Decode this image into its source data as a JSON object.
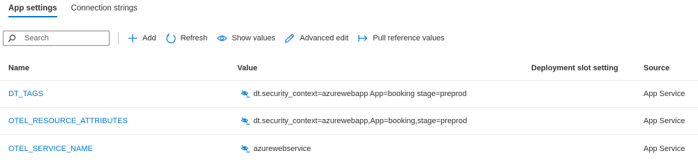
{
  "tabs": [
    {
      "label": "App settings",
      "active": true
    },
    {
      "label": "Connection strings",
      "active": false
    }
  ],
  "toolbar": {
    "search_placeholder": "Search",
    "add_label": "Add",
    "refresh_label": "Refresh",
    "show_values_label": "Show values",
    "advanced_edit_label": "Advanced edit",
    "pull_reference_label": "Pull reference values"
  },
  "table": {
    "headers": {
      "name": "Name",
      "value": "Value",
      "slot": "Deployment slot setting",
      "source": "Source"
    },
    "rows": [
      {
        "name": "DT_TAGS",
        "value": "dt.security_context=azurewebapp App=booking stage=preprod",
        "slot": "",
        "source": "App Service"
      },
      {
        "name": "OTEL_RESOURCE_ATTRIBUTES",
        "value": "dt.security_context=azurewebapp,App=booking,stage=preprod",
        "slot": "",
        "source": "App Service"
      },
      {
        "name": "OTEL_SERVICE_NAME",
        "value": "azurewebservice",
        "slot": "",
        "source": "App Service"
      }
    ]
  },
  "colors": {
    "accent": "#0078d4",
    "text": "#323130",
    "border": "#edebe9"
  },
  "icons": {
    "search": "search-icon",
    "add": "plus-icon",
    "refresh": "refresh-icon",
    "show_values": "eye-icon",
    "advanced_edit": "pencil-icon",
    "pull_reference": "arrow-right-bar-icon",
    "value_hidden": "hidden-value-icon"
  }
}
